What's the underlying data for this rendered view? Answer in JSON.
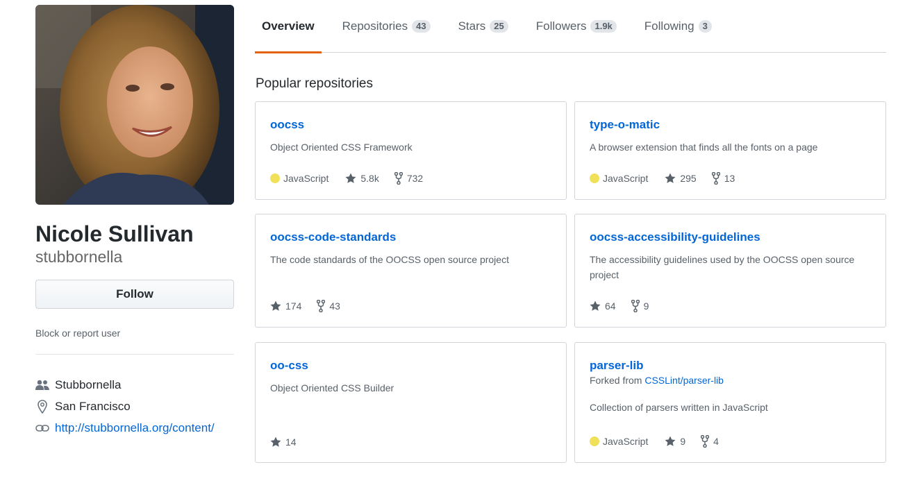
{
  "profile": {
    "fullname": "Nicole Sullivan",
    "username": "stubbornella",
    "follow_label": "Follow",
    "block_label": "Block or report user",
    "organization": "Stubbornella",
    "location": "San Francisco",
    "website": "http://stubbornella.org/content/"
  },
  "tabs": [
    {
      "label": "Overview",
      "count": ""
    },
    {
      "label": "Repositories",
      "count": "43"
    },
    {
      "label": "Stars",
      "count": "25"
    },
    {
      "label": "Followers",
      "count": "1.9k"
    },
    {
      "label": "Following",
      "count": "3"
    }
  ],
  "section_title": "Popular repositories",
  "repos": [
    {
      "name": "oocss",
      "desc": "Object Oriented CSS Framework",
      "lang": "JavaScript",
      "stars": "5.8k",
      "forks": "732"
    },
    {
      "name": "type-o-matic",
      "desc": "A browser extension that finds all the fonts on a page",
      "lang": "JavaScript",
      "stars": "295",
      "forks": "13"
    },
    {
      "name": "oocss-code-standards",
      "desc": "The code standards of the OOCSS open source project",
      "stars": "174",
      "forks": "43"
    },
    {
      "name": "oocss-accessibility-guidelines",
      "desc": "The accessibility guidelines used by the OOCSS open source project",
      "stars": "64",
      "forks": "9"
    },
    {
      "name": "oo-css",
      "desc": "Object Oriented CSS Builder",
      "stars": "14"
    },
    {
      "name": "parser-lib",
      "fork_prefix": "Forked from",
      "fork_source": "CSSLint/parser-lib",
      "desc": "Collection of parsers written in JavaScript",
      "lang": "JavaScript",
      "stars": "9",
      "forks": "4"
    }
  ],
  "colors": {
    "link": "#0366d6",
    "tab_underline": "#e36209",
    "javascript": "#f1e05a"
  }
}
